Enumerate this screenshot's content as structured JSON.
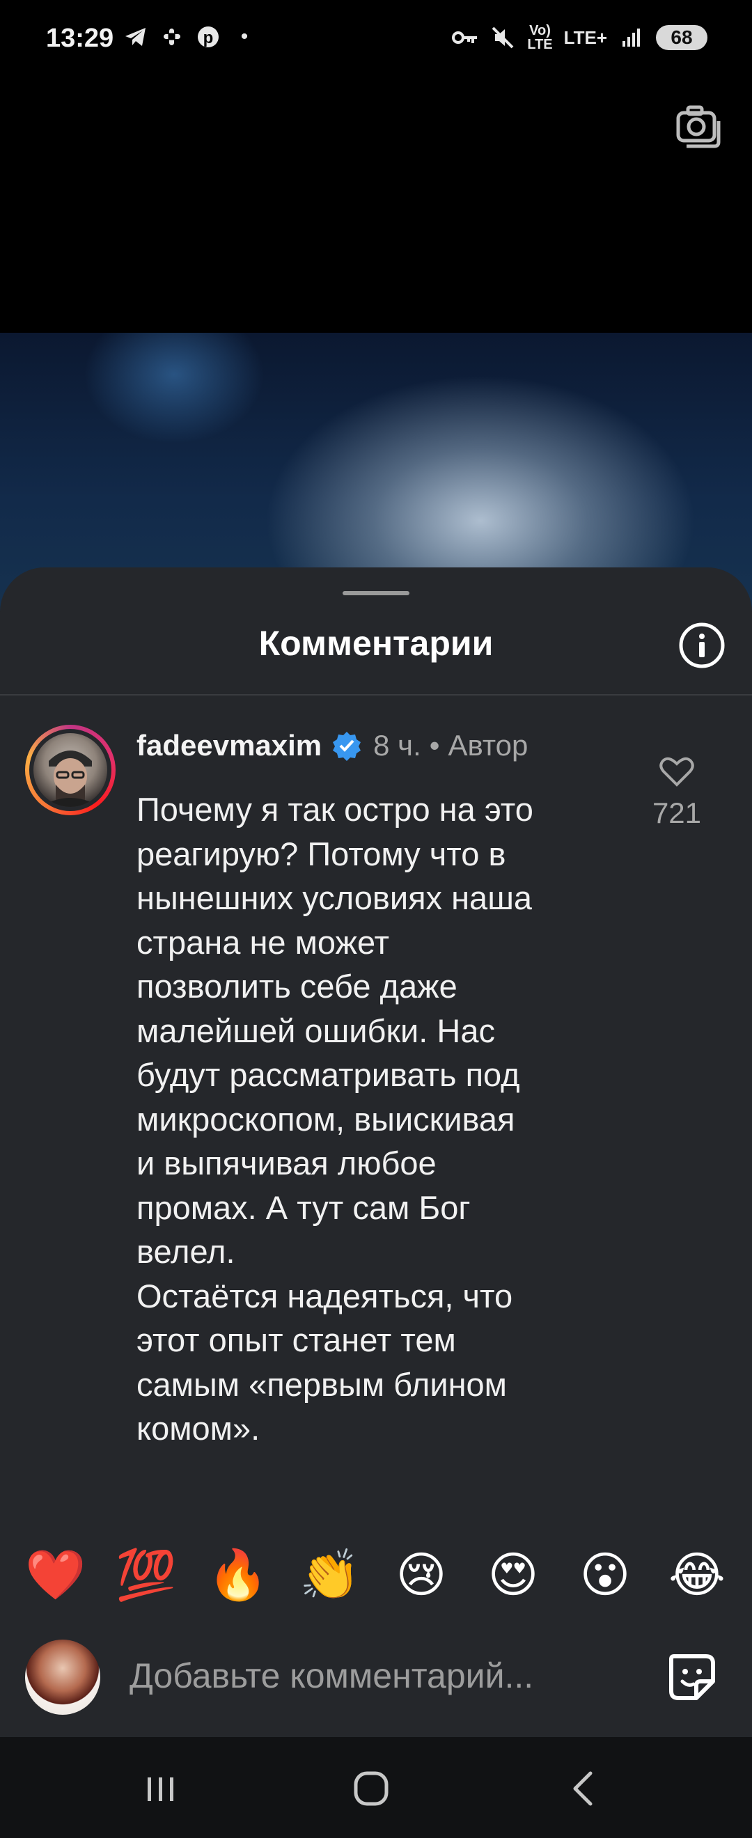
{
  "status_bar": {
    "time": "13:29",
    "dot": "•",
    "net_top": "Vo)",
    "net_bottom": "LTE",
    "lte": "LTE+",
    "battery": "68"
  },
  "sheet": {
    "title": "Комментарии"
  },
  "comment": {
    "username": "fadeevmaxim",
    "time": "8 ч.",
    "separator": "•",
    "author_label": "Автор",
    "likes": "721",
    "text": "Почему я так остро на это\nреагирую? Потому что в\nнынешних условиях наша\nстрана не может\nпозволить себе даже\nмалейшей ошибки. Нас\nбудут рассматривать под\nмикроскопом, выискивая\nи выпячивая любое\nпромах. А тут сам Бог\nвелел.\nОстаётся надеяться, что\nэтот опыт станет тем\nсамым «первым блином\nкомом»."
  },
  "emoji_bar": [
    "❤️",
    "💯",
    "🔥",
    "👏",
    "😢",
    "😍",
    "😮",
    "😂"
  ],
  "composer": {
    "placeholder": "Добавьте комментарий..."
  },
  "colors": {
    "sheet_bg": "#25272b",
    "verified": "#3897f0",
    "muted_text": "#a8a8a8"
  }
}
